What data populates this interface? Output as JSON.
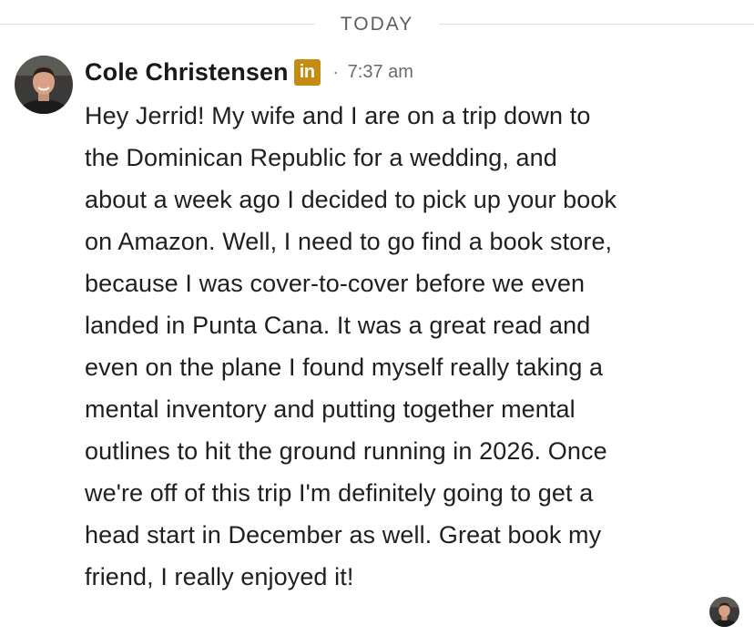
{
  "divider": {
    "label": "TODAY"
  },
  "message": {
    "sender_name": "Cole Christensen",
    "badge_text": "in",
    "badge_color": "#c58b12",
    "separator": "·",
    "time": "7:37 am",
    "lines": [
      "Hey Jerrid! My wife and I are on a trip down to",
      "the Dominican Republic for a wedding, and",
      "about a week ago I decided to pick up your book",
      "on Amazon. Well, I need to go find a book store,",
      "because I was cover-to-cover before we even",
      "landed in Punta Cana. It was a great read and",
      "even on the plane I found myself really taking a",
      "mental inventory and putting together mental",
      "outlines to hit the ground running in 2026. Once",
      "we're off of this trip I'm definitely going to get a",
      "head start in December as well. Great book my",
      "friend, I really enjoyed it!"
    ]
  },
  "icons": {
    "avatar": "profile-photo",
    "badge": "linkedin-premium-badge",
    "read_receipt": "read-receipt-avatar"
  }
}
